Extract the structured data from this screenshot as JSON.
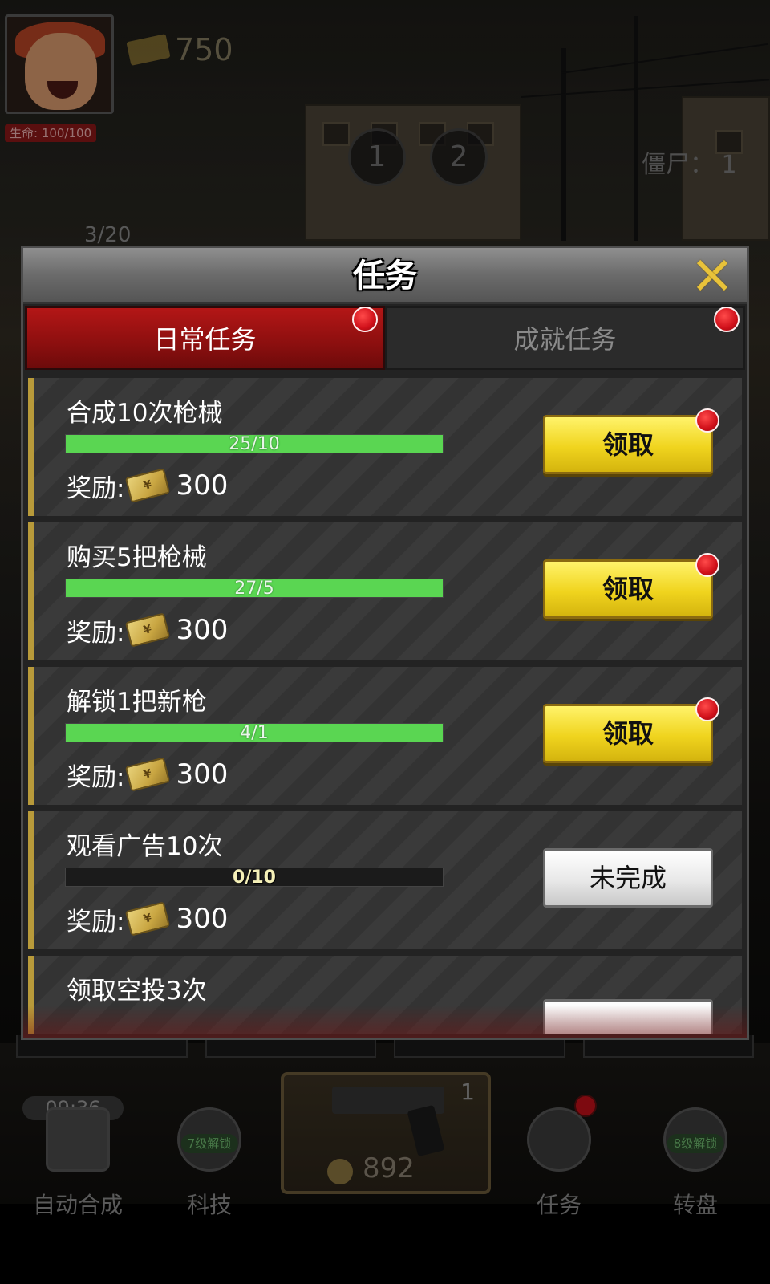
{
  "hud": {
    "life": "生命: 100/100",
    "money": "750",
    "waves": [
      "1",
      "2"
    ],
    "zombies": "僵尸： 1",
    "ammo": "3/20"
  },
  "dialog": {
    "title": "任务",
    "tabs": [
      {
        "label": "日常任务",
        "active": true,
        "badge": true
      },
      {
        "label": "成就任务",
        "active": false,
        "badge": true
      }
    ],
    "reward_label": "奖励:",
    "tasks": [
      {
        "name": "合成10次枪械",
        "progress_text": "25/10",
        "progress_fraction": 1.0,
        "reward": "300",
        "button": "领取",
        "state": "claimable",
        "badge": true
      },
      {
        "name": "购买5把枪械",
        "progress_text": "27/5",
        "progress_fraction": 1.0,
        "reward": "300",
        "button": "领取",
        "state": "claimable",
        "badge": true
      },
      {
        "name": "解锁1把新枪",
        "progress_text": "4/1",
        "progress_fraction": 1.0,
        "reward": "300",
        "button": "领取",
        "state": "claimable",
        "badge": true
      },
      {
        "name": "观看广告10次",
        "progress_text": "0/10",
        "progress_fraction": 0.0,
        "reward": "300",
        "button": "未完成",
        "state": "incomplete",
        "badge": false
      },
      {
        "name": "领取空投3次",
        "progress_text": "",
        "progress_fraction": 0.0,
        "reward": "",
        "button": "",
        "state": "incomplete",
        "badge": false
      }
    ]
  },
  "bottom_nav": {
    "timer": "09:36",
    "items": [
      {
        "label": "自动合成",
        "icon": "auto-merge-icon"
      },
      {
        "label": "科技",
        "icon": "tech-icon",
        "lock": "7级解锁"
      },
      {
        "label": "任务",
        "icon": "task-icon",
        "badge": true
      },
      {
        "label": "转盘",
        "icon": "wheel-icon",
        "lock": "8级解锁"
      }
    ],
    "weapon": {
      "level": "1",
      "cost": "892",
      "icon": "pistol-icon"
    }
  },
  "colors": {
    "accent_gold": "#e8c23a",
    "tab_red": "#b31616",
    "progress_green": "#5ad652",
    "claim_yellow": "#f0d41e",
    "badge_red": "#d0101a"
  }
}
